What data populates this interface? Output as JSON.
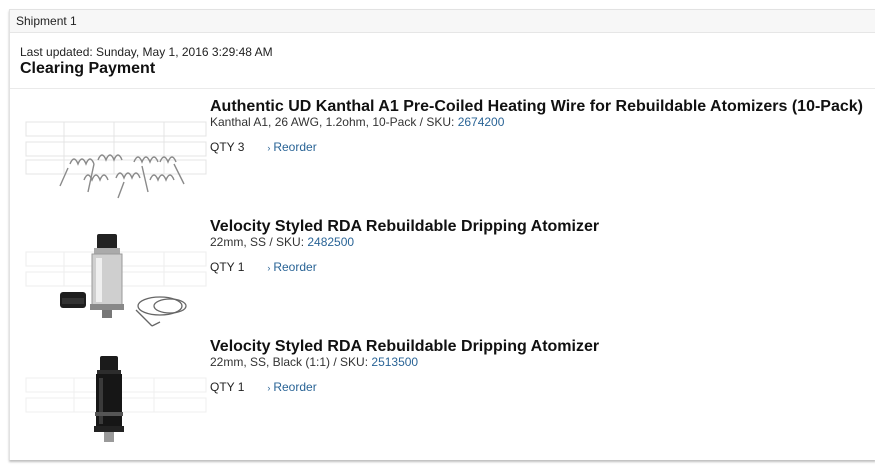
{
  "shipment": {
    "label": "Shipment 1",
    "last_updated": "Last updated: Sunday, May 1, 2016 3:29:48 AM",
    "status": "Clearing Payment"
  },
  "items": [
    {
      "name": "Authentic UD Kanthal A1 Pre-Coiled Heating Wire for Rebuildable Atomizers (10-Pack)",
      "spec": "Kanthal A1, 26 AWG, 1.2ohm, 10-Pack / SKU: ",
      "sku": "2674200",
      "qty": "QTY 3",
      "reorder": "Reorder",
      "image_icon": "coiled-wire-image"
    },
    {
      "name": "Velocity Styled RDA Rebuildable Dripping Atomizer",
      "spec": "22mm, SS / SKU: ",
      "sku": "2482500",
      "qty": "QTY 1",
      "reorder": "Reorder",
      "image_icon": "silver-atomizer-image"
    },
    {
      "name": "Velocity Styled RDA Rebuildable Dripping Atomizer",
      "spec": "22mm, SS, Black (1:1) / SKU: ",
      "sku": "2513500",
      "qty": "QTY 1",
      "reorder": "Reorder",
      "image_icon": "black-atomizer-image"
    }
  ],
  "colors": {
    "link": "#2a6496",
    "header_bg": "#f7f7f7"
  }
}
